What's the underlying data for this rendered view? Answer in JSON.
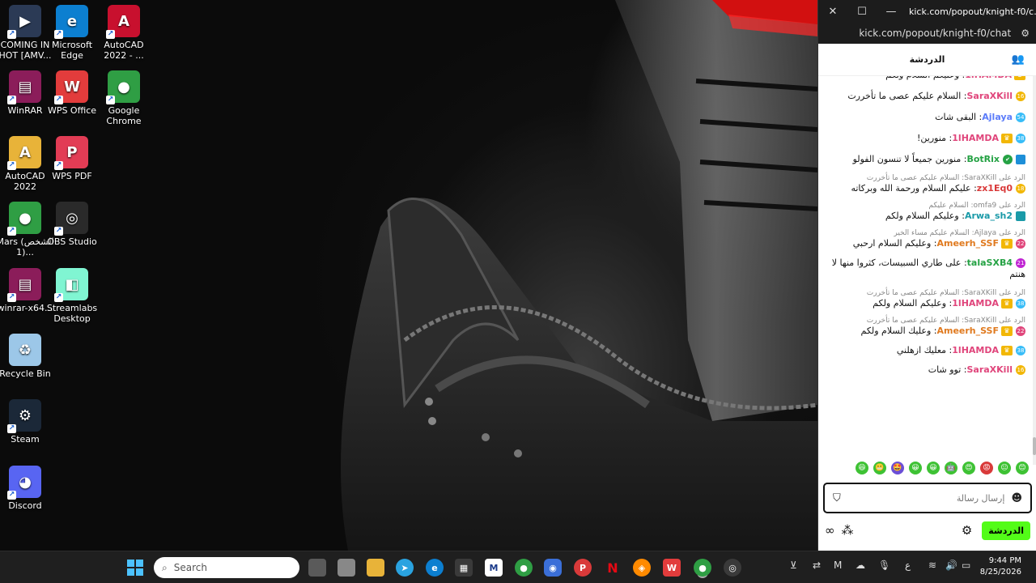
{
  "desktop": {
    "icons": [
      {
        "label": "COMING IN HOT [AMV...",
        "icon": "video-file-icon",
        "color": "#2b3a55"
      },
      {
        "label": "Microsoft Edge",
        "icon": "edge-icon",
        "color": "#0c7fd0"
      },
      {
        "label": "AutoCAD 2022 - ...",
        "icon": "autocad-icon",
        "color": "#c8102e"
      },
      {
        "label": "WinRAR",
        "icon": "winrar-icon",
        "color": "#8b1d5a"
      },
      {
        "label": "WPS Office",
        "icon": "wps-office-icon",
        "color": "#e23c3c"
      },
      {
        "label": "Google Chrome",
        "icon": "chrome-icon",
        "color": "#2f9e44"
      },
      {
        "label": "AutoCAD 2022",
        "icon": "autocad-folder-icon",
        "color": "#e8b339"
      },
      {
        "label": "WPS PDF",
        "icon": "wps-pdf-icon",
        "color": "#e23c55"
      },
      {
        "label": "Mars (الشخص 1)...",
        "icon": "chrome-profile-icon",
        "color": "#2f9e44"
      },
      {
        "label": "OBS Studio",
        "icon": "obs-icon",
        "color": "#2a2a2a"
      },
      {
        "label": "winrar-x64...",
        "icon": "winrar-installer-icon",
        "color": "#8b1d5a"
      },
      {
        "label": "Streamlabs Desktop",
        "icon": "streamlabs-icon",
        "color": "#80f5d2"
      },
      {
        "label": "Recycle Bin",
        "icon": "recycle-bin-icon",
        "color": "#9cc7e8"
      },
      {
        "label": "Steam",
        "icon": "steam-icon",
        "color": "#1b2838"
      },
      {
        "label": "Discord",
        "icon": "discord-icon",
        "color": "#5865f2"
      }
    ]
  },
  "chat_window": {
    "title_url": "kick.com/popout/knight-f0/c...",
    "address": "kick.com/popout/knight-f0/chat",
    "header_title": "الدردشة",
    "messages": [
      {
        "user": "1lHAMDA",
        "text": "وعليكم السلام ولكم",
        "color": "#e0457b",
        "badge": "",
        "crown": true,
        "partial": true
      },
      {
        "user": "SaraXKill",
        "text": "السلام عليكم عصى ما تأخررت",
        "color": "#e0457b",
        "badge": "16",
        "badge_color": "#f2b705",
        "crown": false
      },
      {
        "user": "Ajlaya",
        "text": "البقى شات",
        "color": "#5b7cfa",
        "badge": "54",
        "badge_color": "#38bdf8",
        "crown": false
      },
      {
        "user": "1lHAMDA",
        "text": "منورين!",
        "color": "#e0457b",
        "badge": "38",
        "badge_color": "#38bdf8",
        "crown": true
      },
      {
        "user": "BotRix",
        "text": "منورين جميعاً لا تنسون الفولو",
        "color": "#25a244",
        "badge": "",
        "badge_color": "#1d8fd8",
        "crown": false,
        "verified": true
      },
      {
        "reply": "الرد على SaraXKill: السلام عليكم عصى ما تأخررت",
        "user": "zx1Eq0",
        "text": "عليكم السلام ورحمة الله وبركاته",
        "color": "#d93a3a",
        "badge": "18",
        "badge_color": "#f2b705",
        "crown": false
      },
      {
        "reply": "الرد على omfa9: السلام عليكم",
        "user": "Arwa_sh2",
        "text": "وعليكم السلام ولكم",
        "color": "#1a9aa8",
        "badge": "",
        "badge_color": "#1a9aa8",
        "crown": false
      },
      {
        "reply": "الرد على Ajlaya: السلام عليكم مساء الخير",
        "user": "Ameerh_SSF",
        "text": "وعليكم السلام ارحبي",
        "color": "#e07a1f",
        "badge": "22",
        "badge_color": "#e0457b",
        "crown": true
      },
      {
        "user": "talaSXB4",
        "text": "على طاري السبيسات، كثروا منها لا هنتم",
        "color": "#25a244",
        "badge": "21",
        "badge_color": "#c026d3",
        "crown": false
      },
      {
        "reply": "الرد على SaraXKill: السلام عليكم عصى ما تأخررت",
        "user": "1lHAMDA",
        "text": "وعليكم السلام ولكم",
        "color": "#e0457b",
        "badge": "38",
        "badge_color": "#38bdf8",
        "crown": true
      },
      {
        "reply": "الرد على SaraXKill: السلام عليكم عصى ما تأخررت",
        "user": "Ameerh_SSF",
        "text": "وعليك السلام ولكم",
        "color": "#e07a1f",
        "badge": "22",
        "badge_color": "#e0457b",
        "crown": true
      },
      {
        "user": "1lHAMDA",
        "text": "معليك ازهلني",
        "color": "#e0457b",
        "badge": "38",
        "badge_color": "#38bdf8",
        "crown": true
      },
      {
        "user": "SaraXKill",
        "text": "توو شات",
        "color": "#e0457b",
        "badge": "16",
        "badge_color": "#f2b705",
        "crown": false
      }
    ],
    "input_placeholder": "إرسال رسالة",
    "chat_button": "الدردشة"
  },
  "taskbar": {
    "search_placeholder": "Search",
    "time": "9:44 PM",
    "date": "8/25/2026",
    "lang": "ع"
  }
}
